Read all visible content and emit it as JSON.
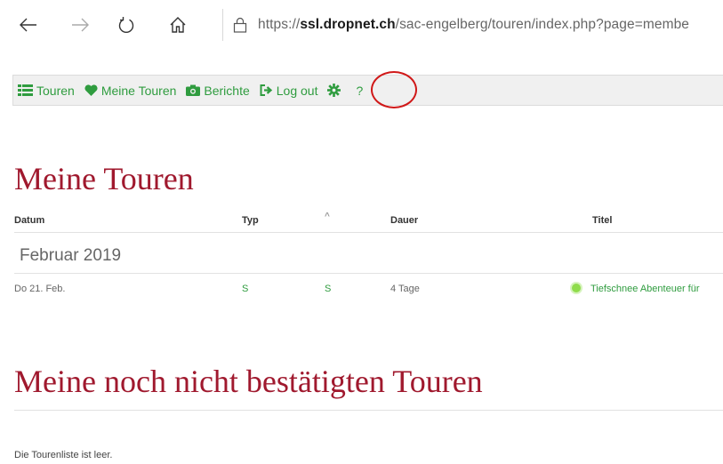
{
  "browser": {
    "url_prefix": "https://",
    "url_domain": "ssl.dropnet.ch",
    "url_path": "/sac-engelberg/touren/index.php?page=membe"
  },
  "navbar": {
    "items": [
      {
        "label": "Touren",
        "icon": "list-icon"
      },
      {
        "label": "Meine Touren",
        "icon": "heart-icon"
      },
      {
        "label": "Berichte",
        "icon": "camera-icon"
      },
      {
        "label": "Log out",
        "icon": "logout-icon"
      },
      {
        "label": "",
        "icon": "gear-icon"
      },
      {
        "label": "?",
        "icon": ""
      }
    ],
    "accent": "#2f9c3f"
  },
  "meine_touren": {
    "heading": "Meine Touren",
    "columns": {
      "datum": "Datum",
      "typ": "Typ",
      "sort": "^",
      "dauer": "Dauer",
      "titel": "Titel"
    },
    "month": "Februar 2019",
    "rows": [
      {
        "datum": "Do 21. Feb.",
        "typ": "S",
        "col3": "S",
        "dauer": "4 Tage",
        "titel": "Tiefschnee Abenteuer für",
        "status_color": "#8fdc4b"
      }
    ]
  },
  "unbestaetigt": {
    "heading": "Meine noch nicht bestätigten Touren",
    "empty_text": "Die Tourenliste ist leer."
  },
  "colors": {
    "heading": "#a0192e",
    "highlight": "#d01818"
  }
}
